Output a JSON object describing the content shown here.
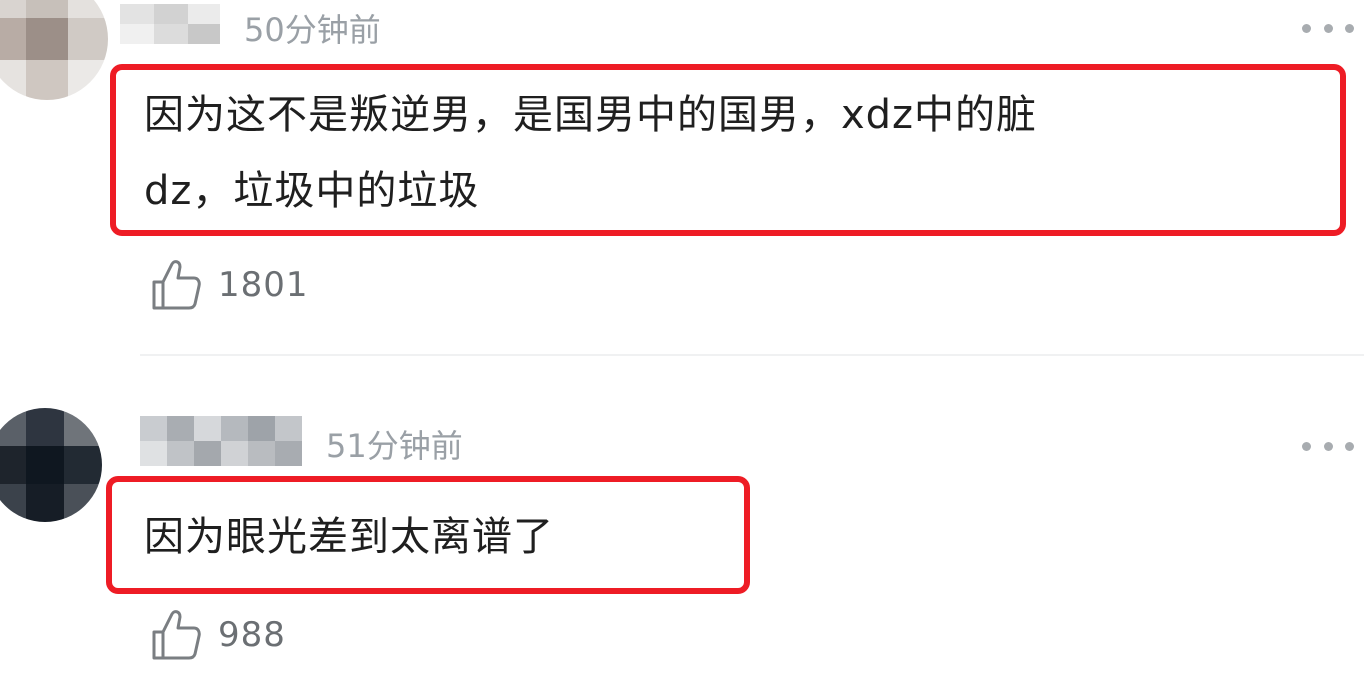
{
  "comments": [
    {
      "timestamp": "50分钟前",
      "text_line1": "因为这不是叛逆男，是国男中的国男，xdz中的脏",
      "text_line2": "dz，垃圾中的垃圾",
      "likes": "1801",
      "more_icon": "more-horizontal-icon",
      "like_icon": "thumbs-up-icon"
    },
    {
      "timestamp": "51分钟前",
      "text_line1": "因为眼光差到太离谱了",
      "likes": "988",
      "more_icon": "more-horizontal-icon",
      "like_icon": "thumbs-up-icon"
    }
  ],
  "colors": {
    "highlight": "#ee1c25",
    "timestamp": "#9aa0a6",
    "text": "#1f1f1f",
    "like_count": "#6b6f73"
  }
}
